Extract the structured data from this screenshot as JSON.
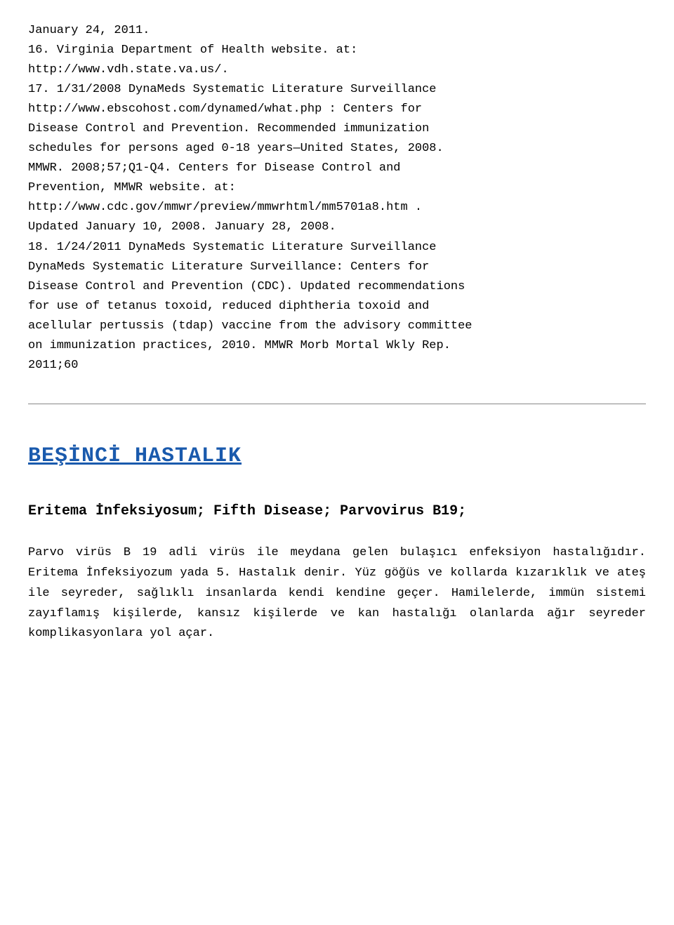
{
  "references": {
    "lines": [
      "January 24, 2011.",
      "16. Virginia Department of Health website. at:",
      "http://www.vdh.state.va.us/.",
      "17. 1/31/2008 DynaMeds Systematic Literature Surveillance",
      "http://www.ebscohost.com/dynamed/what.php : Centers for",
      "Disease Control and Prevention. Recommended immunization",
      "schedules for persons aged 0-18 years—United States, 2008.",
      "MMWR. 2008;57;Q1-Q4. Centers for Disease Control and",
      "Prevention,  MMWR  website.  at:",
      "http://www.cdc.gov/mmwr/preview/mmwrhtml/mm5701a8.htm .",
      "Updated January 10, 2008. January 28, 2008.",
      "18. 1/24/2011 DynaMeds Systematic Literature Surveillance",
      "DynaMeds Systematic Literature Surveillance: Centers for",
      "Disease Control and Prevention (CDC). Updated recommendations",
      "for use of tetanus toxoid, reduced diphtheria toxoid and",
      "acellular pertussis (tdap) vaccine from the advisory committee",
      "on immunization practices, 2010. MMWR Morb Mortal Wkly Rep.",
      "2011;60"
    ]
  },
  "divider": true,
  "section": {
    "title": "BEŞİNCİ HASTALIK",
    "subtitle": "Eritema İnfeksiyosum; Fifth Disease; Parvovirus B19;",
    "body": "Parvo virüs B 19 adli virüs ile meydana gelen bulaşıcı enfeksiyon hastalığıdır. Eritema İnfeksiyozum yada 5. Hastalık denir. Yüz göğüs ve kollarda kızarıklık ve ateş ile seyreder, sağlıklı insanlarda kendi kendine geçer. Hamilelerde, immün sistemi zayıflamış kişilerde, kansız kişilerde ve kan hastalığı olanlarda ağır seyreder komplikasyonlara yol açar."
  }
}
